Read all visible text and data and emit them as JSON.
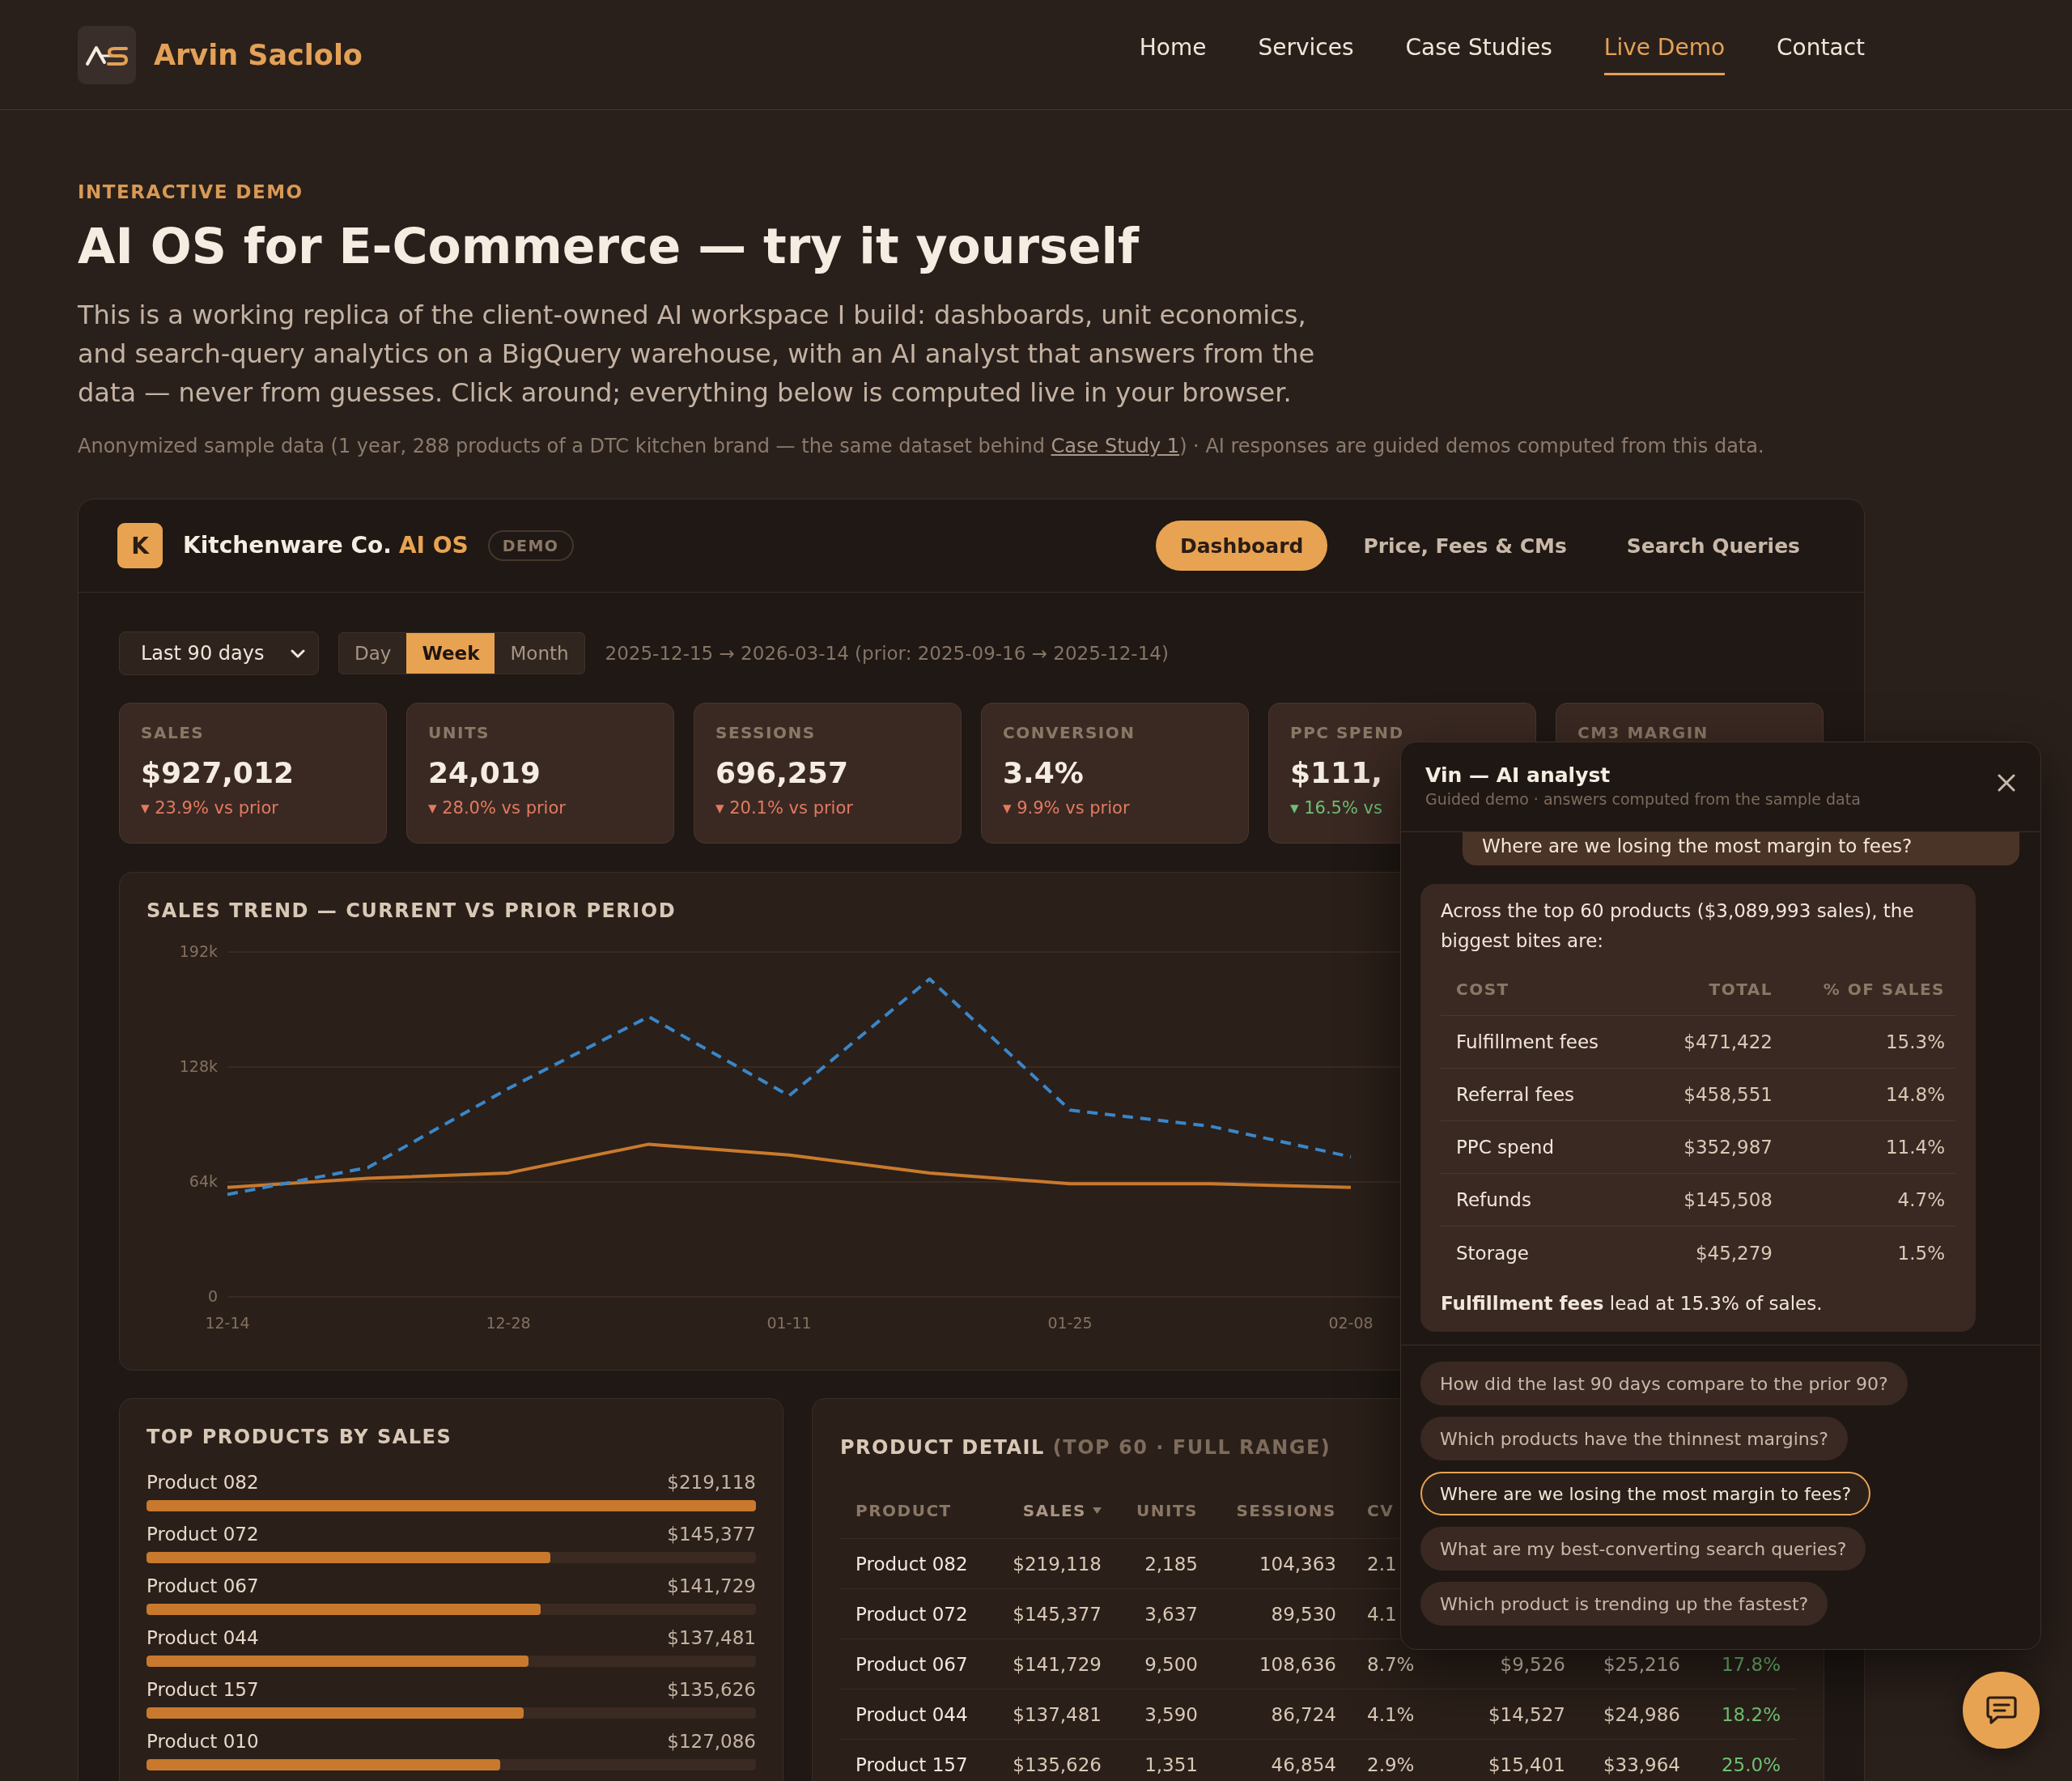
{
  "header": {
    "brand": "Arvin Saclolo",
    "nav": [
      {
        "label": "Home",
        "selected": false
      },
      {
        "label": "Services",
        "selected": false
      },
      {
        "label": "Case Studies",
        "selected": false
      },
      {
        "label": "Live Demo",
        "selected": true
      },
      {
        "label": "Contact",
        "selected": false
      }
    ]
  },
  "intro": {
    "eyebrow": "INTERACTIVE DEMO",
    "title": "AI OS for E-Commerce — try it yourself",
    "lead": "This is a working replica of the client-owned AI workspace I build: dashboards, unit economics, and search-query analytics on a BigQuery warehouse, with an AI analyst that answers from the data — never from guesses. Click around; everything below is computed live in your browser.",
    "note": {
      "before": "Anonymized sample data (1 year, 288 products of a DTC kitchen brand — the same dataset behind ",
      "link": "Case Study 1",
      "after": ") · AI responses are guided demos computed from this data."
    }
  },
  "demo": {
    "monogram": "K",
    "company": "Kitchenware Co.",
    "product": "AI OS",
    "badge": "DEMO",
    "tabs": [
      {
        "label": "Dashboard",
        "selected": true
      },
      {
        "label": "Price, Fees & CMs",
        "selected": false
      },
      {
        "label": "Search Queries",
        "selected": false
      }
    ],
    "range_select": {
      "value": "Last 90 days"
    },
    "granularity": [
      {
        "label": "Day",
        "selected": false
      },
      {
        "label": "Week",
        "selected": true
      },
      {
        "label": "Month",
        "selected": false
      }
    ],
    "date_range": "2025-12-15 → 2026-03-14 (prior: 2025-09-16 → 2025-12-14)",
    "kpis": [
      {
        "label": "SALES",
        "value": "$927,012",
        "delta": "▾ 23.9% vs prior",
        "favorable": false
      },
      {
        "label": "UNITS",
        "value": "24,019",
        "delta": "▾ 28.0% vs prior",
        "favorable": false
      },
      {
        "label": "SESSIONS",
        "value": "696,257",
        "delta": "▾ 20.1% vs prior",
        "favorable": false
      },
      {
        "label": "CONVERSION",
        "value": "3.4%",
        "delta": "▾ 9.9% vs prior",
        "favorable": false
      },
      {
        "label": "PPC SPEND",
        "value": "$111,",
        "delta": "▾ 16.5% vs",
        "favorable": true
      },
      {
        "label": "CM3 MARGIN"
      }
    ],
    "sales_trend": {
      "chart_data": {
        "type": "line",
        "title": "SALES TREND — CURRENT VS PRIOR PERIOD",
        "categories": [
          "12-14",
          null,
          "12-28",
          null,
          "01-11",
          null,
          "01-25",
          null,
          "02-08"
        ],
        "ylim": [
          0,
          192000
        ],
        "yticks": [
          {
            "value": 0,
            "label": "0"
          },
          {
            "value": 64000,
            "label": "64k"
          },
          {
            "value": 128000,
            "label": "128k"
          },
          {
            "value": 192000,
            "label": "192k"
          }
        ],
        "series": [
          {
            "color": "#c97a2c",
            "line_style": "solid",
            "values": [
              61000,
              66000,
              69000,
              85000,
              79000,
              69000,
              63000,
              63000,
              61000
            ]
          },
          {
            "color": "#3a86c8",
            "line_style": "dashed",
            "values": [
              57000,
              72000,
              116000,
              156000,
              112000,
              177000,
              104000,
              95000,
              78000
            ]
          }
        ]
      }
    },
    "top_products": {
      "title": "TOP PRODUCTS BY SALES",
      "items": [
        {
          "name": "Product 082",
          "value": "$219,118",
          "level": 1
        },
        {
          "name": "Product 072",
          "value": "$145,377",
          "level": 0.663
        },
        {
          "name": "Product 067",
          "value": "$141,729",
          "level": 0.647
        },
        {
          "name": "Product 044",
          "value": "$137,481",
          "level": 0.627
        },
        {
          "name": "Product 157",
          "value": "$135,626",
          "level": 0.619
        },
        {
          "name": "Product 010",
          "value": "$127,086",
          "level": 0.58
        }
      ]
    },
    "product_detail": {
      "title": "PRODUCT DETAIL",
      "subtitle": "(TOP 60 · FULL RANGE)",
      "columns": [
        {
          "label": "PRODUCT",
          "sorted": false
        },
        {
          "label": "SALES",
          "sorted": true
        },
        {
          "label": "UNITS",
          "sorted": false
        },
        {
          "label": "SESSIONS",
          "sorted": false
        },
        {
          "label": "CV",
          "sorted": false
        }
      ],
      "rows": [
        [
          "Product 082",
          "$219,118",
          "2,185",
          "104,363",
          "2.1"
        ],
        [
          "Product 072",
          "$145,377",
          "3,637",
          "89,530",
          "4.1"
        ],
        [
          "Product 067",
          "$141,729",
          "9,500",
          "108,636",
          "8.7%",
          "$9,526",
          "$25,216",
          "17.8%"
        ],
        [
          "Product 044",
          "$137,481",
          "3,590",
          "86,724",
          "4.1%",
          "$14,527",
          "$24,986",
          "18.2%"
        ],
        [
          "Product 157",
          "$135,626",
          "1,351",
          "46,854",
          "2.9%",
          "$15,401",
          "$33,964",
          "25.0%"
        ]
      ]
    }
  },
  "assistant": {
    "title": "Vin — AI analyst",
    "subtitle": "Guided demo · answers computed from the sample data",
    "question": "Where are we losing the most margin to fees?",
    "answer": {
      "intro": "Across the top 60 products ($3,089,993 sales), the biggest bites are:",
      "columns": [
        "COST",
        "TOTAL",
        "% OF SALES"
      ],
      "rows": [
        [
          "Fulfillment fees",
          "$471,422",
          "15.3%"
        ],
        [
          "Referral fees",
          "$458,551",
          "14.8%"
        ],
        [
          "PPC spend",
          "$352,987",
          "11.4%"
        ],
        [
          "Refunds",
          "$145,508",
          "4.7%"
        ],
        [
          "Storage",
          "$45,279",
          "1.5%"
        ]
      ],
      "summary": "**Fulfillment fees** lead at 15.3% of sales."
    },
    "suggestions": [
      {
        "text": "How did the last 90 days compare to the prior 90?",
        "selected": false
      },
      {
        "text": "Which products have the thinnest margins?",
        "selected": false
      },
      {
        "text": "Where are we losing the most margin to fees?",
        "selected": true
      },
      {
        "text": "What are my best-converting search queries?",
        "selected": false
      },
      {
        "text": "Which product is trending up the fastest?",
        "selected": false
      }
    ]
  }
}
